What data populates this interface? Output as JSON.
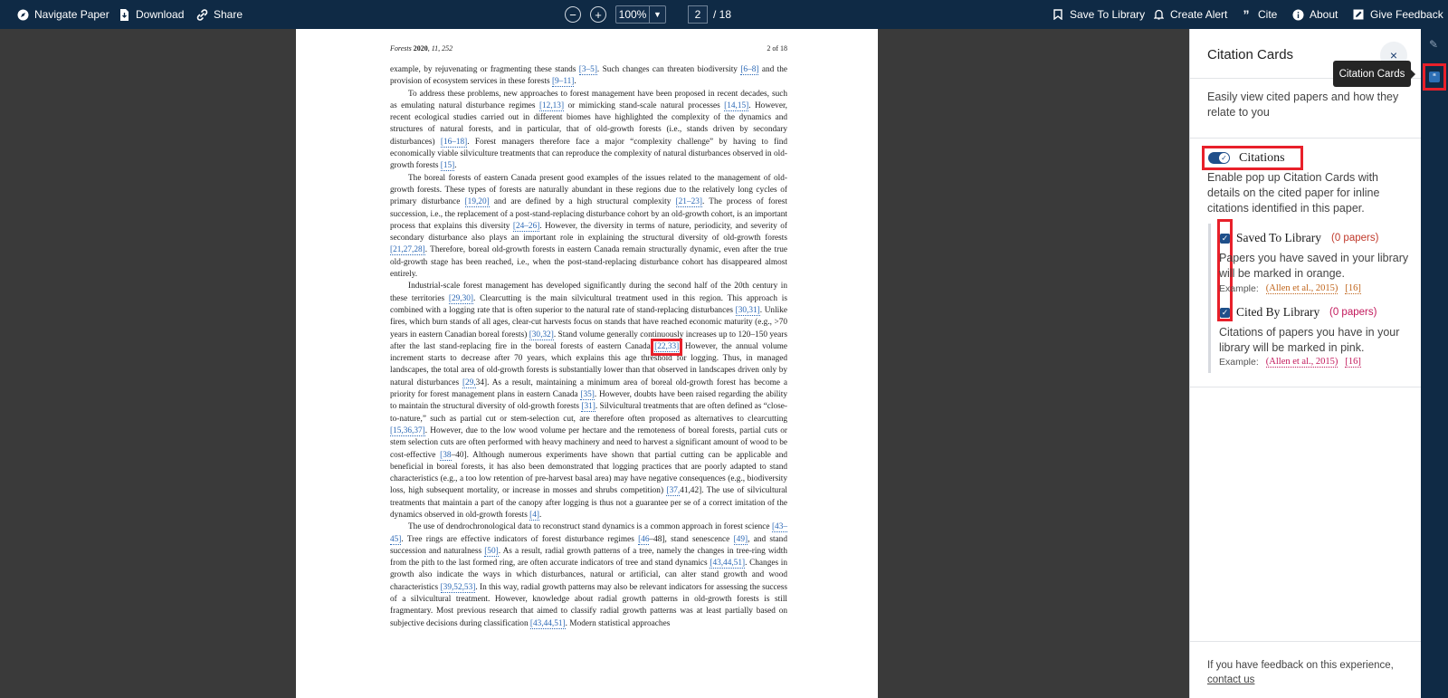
{
  "toolbar": {
    "navigate": "Navigate Paper",
    "download": "Download",
    "share": "Share",
    "zoom_out": "−",
    "zoom_in": "+",
    "zoom": "100%",
    "page_current": "2",
    "page_total": "/ 18",
    "save_to_library": "Save To Library",
    "create_alert": "Create Alert",
    "cite": "Cite",
    "about": "About",
    "give_feedback": "Give Feedback",
    "icons": [
      "compass-icon",
      "download-icon",
      "share-icon",
      "bookmark-icon",
      "bell-icon",
      "quote-icon",
      "info-icon",
      "feedback-icon"
    ]
  },
  "document": {
    "journal": "Forests",
    "year": "2020",
    "volume_issue": ", 11, 252",
    "page_label": "2 of 18",
    "paragraphs": [
      [
        {
          "t": "example, by rejuvenating or fragmenting these stands "
        },
        {
          "c": "[3–5]"
        },
        {
          "t": ". Such changes can threaten biodiversity "
        },
        {
          "c": "[6–8]"
        },
        {
          "t": " and the provision of ecosystem services in these forests "
        },
        {
          "c": "[9–11]"
        },
        {
          "t": "."
        }
      ],
      [
        {
          "t": "To address these problems, new approaches to forest management have been proposed in recent decades, such as emulating natural disturbance regimes "
        },
        {
          "c": "[12,13]"
        },
        {
          "t": " or mimicking stand-scale natural processes "
        },
        {
          "c": "[14,15]"
        },
        {
          "t": ". However, recent ecological studies carried out in different biomes have highlighted the complexity of the dynamics and structures of natural forests, and in particular, that of old-growth forests (i.e., stands driven by secondary disturbances) "
        },
        {
          "c": "[16–18]"
        },
        {
          "t": ". Forest managers therefore face a major “complexity challenge” by having to find economically viable silviculture treatments that can reproduce the complexity of natural disturbances observed in old-growth forests "
        },
        {
          "c": "[15]"
        },
        {
          "t": "."
        }
      ],
      [
        {
          "t": "The boreal forests of eastern Canada present good examples of the issues related to the management of old-growth forests. These types of forests are naturally abundant in these regions due to the relatively long cycles of primary disturbance "
        },
        {
          "c": "[19,20]"
        },
        {
          "t": " and are defined by a high structural complexity "
        },
        {
          "c": "[21–23]"
        },
        {
          "t": ". The process of forest succession, i.e., the replacement of a post-stand-replacing disturbance cohort by an old-growth cohort, is an important process that explains this diversity "
        },
        {
          "c": "[24–26]"
        },
        {
          "t": ". However, the diversity in terms of nature, periodicity, and severity of secondary disturbance also plays an important role in explaining the structural diversity of old-growth forests "
        },
        {
          "c": "[21,27,28]"
        },
        {
          "t": ". Therefore, boreal old-growth forests in eastern Canada remain structurally dynamic, even after the true old-growth stage has been reached, i.e., when the post-stand-replacing disturbance cohort has disappeared almost entirely."
        }
      ],
      [
        {
          "t": "Industrial-scale forest management has developed significantly during the second half of the 20th century in these territories "
        },
        {
          "c": "[29,30]"
        },
        {
          "t": ". Clearcutting is the main silvicultural treatment used in this region. This approach is combined with a logging rate that is often superior to the natural rate of stand-replacing disturbances "
        },
        {
          "c": "[30,31]"
        },
        {
          "t": ". Unlike fires, which burn stands of all ages, clear-cut harvests focus on stands that have reached economic maturity (e.g., >70 years in eastern Canadian boreal forests) "
        },
        {
          "c": "[30,32]"
        },
        {
          "t": ". Stand volume generally continuously increases up to 120–150 years after the last stand-replacing fire in the boreal forests of eastern Canada "
        },
        {
          "c": "[22,33]",
          "hl": true
        },
        {
          "t": ". However, the annual volume increment starts to decrease after 70 years, which explains this age threshold for logging. Thus, in managed landscapes, the total area of old-growth forests is substantially lower than that observed in landscapes driven only by natural disturbances "
        },
        {
          "c": "[29,"
        },
        {
          "t": "34]. As a result, maintaining a minimum area of boreal old-growth forest has become a priority for forest management plans in eastern Canada "
        },
        {
          "c": "[35]"
        },
        {
          "t": ". However, doubts have been raised regarding the ability to maintain the structural diversity of old-growth forests "
        },
        {
          "c": "[31]"
        },
        {
          "t": ". Silvicultural treatments that are often defined as “close-to-nature,” such as partial cut or stem-selection cut, are therefore often proposed as alternatives to clearcutting "
        },
        {
          "c": "[15,36,37]"
        },
        {
          "t": ". However, due to the low wood volume per hectare and the remoteness of boreal forests, partial cuts or stem selection cuts are often performed with heavy machinery and need to harvest a significant amount of wood to be cost-effective "
        },
        {
          "c": "[38"
        },
        {
          "t": "–40]. Although numerous experiments have shown that partial cutting can be applicable and beneficial in boreal forests, it has also been demonstrated that logging practices that are poorly adapted to stand characteristics (e.g., a too low retention of pre-harvest basal area) may have negative consequences (e.g., biodiversity loss, high subsequent mortality, or increase in mosses and shrubs competition) "
        },
        {
          "c": "[37,"
        },
        {
          "t": "41,42]. The use of silvicultural treatments that maintain a part of the canopy after logging is thus not a guarantee per se of a correct imitation of the dynamics observed in old-growth forests "
        },
        {
          "c": "[4]"
        },
        {
          "t": "."
        }
      ],
      [
        {
          "t": "The use of dendrochronological data to reconstruct stand dynamics is a common approach in forest science "
        },
        {
          "c": "[43–45]"
        },
        {
          "t": ". Tree rings are effective indicators of forest disturbance regimes "
        },
        {
          "c": "[46"
        },
        {
          "t": "–48], stand senescence "
        },
        {
          "c": "[49]"
        },
        {
          "t": ", and stand succession and naturalness "
        },
        {
          "c": "[50]"
        },
        {
          "t": ". As a result, radial growth patterns of a tree, namely the changes in tree-ring width from the pith to the last formed ring, are often accurate indicators of tree and stand dynamics "
        },
        {
          "c": "[43,44,51]"
        },
        {
          "t": ". Changes in growth also indicate the ways in which disturbances, natural or artificial, can alter stand growth and wood characteristics "
        },
        {
          "c": "[39,52,53]"
        },
        {
          "t": ". In this way, radial growth patterns may also be relevant indicators for assessing the success of a silvicultural treatment. However, knowledge about radial growth patterns in old-growth forests is still fragmentary. Most previous research that aimed to classify radial growth patterns was at least partially based on subjective decisions during classification "
        },
        {
          "c": "[43,44,51]"
        },
        {
          "t": ". Modern statistical approaches"
        }
      ]
    ]
  },
  "panel": {
    "title": "Citation Cards",
    "close": "×",
    "description": "Easily view cited papers and how they relate to you",
    "toggle_label": "Citations",
    "toggle_checked": true,
    "toggle_description": "Enable pop up Citation Cards with details on the cited paper for inline citations identified in this paper.",
    "saved": {
      "label": "Saved To Library",
      "count": "(0 papers)",
      "description": "Papers you have saved in your library will be marked in orange.",
      "example_label": "Example:",
      "example_cite": "(Allen et al., 2015)",
      "example_num": "[16]",
      "color": "#c0641a"
    },
    "cited": {
      "label": "Cited By Library",
      "count": "(0 papers)",
      "description": "Citations of papers you have in your library will be marked in pink.",
      "example_label": "Example:",
      "example_cite": "(Allen et al., 2015)",
      "example_num": "[16]",
      "color": "#c2185b"
    },
    "footer_text": "If you have feedback on this experience,",
    "footer_link": "contact us"
  },
  "rail": {
    "tooltip": "Citation Cards",
    "icons": [
      "pencil-icon",
      "citation-cards-icon"
    ]
  },
  "colors": {
    "toolbar_bg": "#0f2a45",
    "accent": "#1f4f8a",
    "highlight": "#e8202a",
    "citation_link": "#2a67b5"
  }
}
